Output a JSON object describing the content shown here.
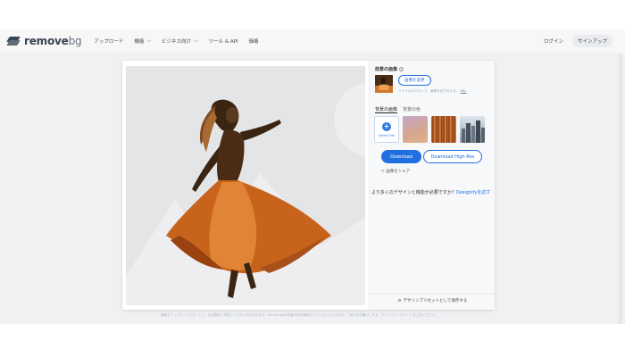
{
  "app": {
    "logo_main": "remove",
    "logo_suffix": "bg"
  },
  "nav": {
    "items": [
      {
        "label": "アップロード",
        "has_dropdown": false
      },
      {
        "label": "機能",
        "has_dropdown": true
      },
      {
        "label": "ビジネス向け",
        "has_dropdown": true
      },
      {
        "label": "ツール & API",
        "has_dropdown": false
      },
      {
        "label": "価格",
        "has_dropdown": false
      }
    ],
    "login": "ログイン",
    "signup": "サインアップ"
  },
  "panel": {
    "original_title": "前景の画像",
    "change_image": "画像を変更",
    "note": "ファイルのクロップ、画像を切り付ける。",
    "note_link": "URL",
    "tabs": [
      "背景の画像",
      "背景の色"
    ],
    "active_tab": "背景の画像",
    "select_file": "Select File",
    "download": "Download",
    "download_hi": "Download High-Res",
    "share": "画像をシェア",
    "promo_text": "より多くのデザインと機能が必要ですか？",
    "promo_link": "Designifyを試す",
    "save_preset": "デザインプリセットとして保存する"
  },
  "footer": {
    "disclaimer": "画像をアップロードすることで、当社規約 に同意したものとみなされます。remove.bgの背景の除去機能をさらに向上させるため、ご協力をお願いします。プライバシーポリシー をご覧ください。"
  },
  "colors": {
    "accent": "#1f6fe0",
    "nav_text": "#3c4550"
  },
  "icons": [
    "removebg-logo-icon",
    "chevron-down-icon",
    "info-icon",
    "plus-icon",
    "share-icon",
    "gear-icon"
  ]
}
